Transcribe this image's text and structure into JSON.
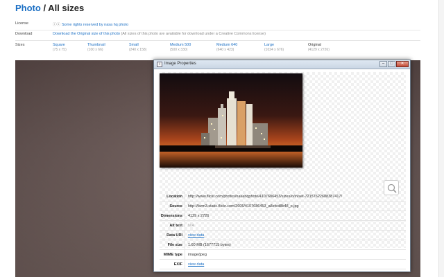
{
  "header": {
    "title_link": "Photo",
    "title_rest": " / All sizes"
  },
  "info": {
    "license_label": "License",
    "license_icons": "ⓘⓢ",
    "license_link": "Some rights reserved by nasa hq photo",
    "download_label": "Download",
    "download_link": "Download the Original size of this photo",
    "download_note": "(All sizes of this photo are available for download under a Creative Commons license)",
    "sizes_label": "Sizes",
    "sizes": [
      {
        "name": "Square",
        "dim": "(75 x 75)"
      },
      {
        "name": "Thumbnail",
        "dim": "(100 x 66)"
      },
      {
        "name": "Small",
        "dim": "(240 x 158)"
      },
      {
        "name": "Medium 500",
        "dim": "(500 x 330)"
      },
      {
        "name": "Medium 640",
        "dim": "(640 x 423)"
      },
      {
        "name": "Large",
        "dim": "(1024 x 676)"
      },
      {
        "name": "Original",
        "dim": "(4129 x 2726)"
      }
    ]
  },
  "dialog": {
    "title": "Image Properties",
    "icon_glyph": "i",
    "buttons": {
      "minimize": "–",
      "maximize": "□",
      "close": "✕"
    },
    "properties": [
      {
        "key": "Location",
        "value": "http://www.flickr.com/photos/nasahqphoto/4107686453/sizes/o/in/set-72157622688387417/",
        "style": ""
      },
      {
        "key": "Source",
        "value": "http://farm3.static.flickr.com/2605/4107686453_a8efed8b48_o.jpg",
        "style": ""
      },
      {
        "key": "Dimensions",
        "value": "4129 x 2726",
        "style": ""
      },
      {
        "key": "Alt text",
        "value": "N/A",
        "style": "muted"
      },
      {
        "key": "Data URI",
        "value": "view data",
        "style": "link"
      },
      {
        "key": "File size",
        "value": "1.60 MB (1677715 bytes)",
        "style": ""
      },
      {
        "key": "MIME type",
        "value": "image/jpeg",
        "style": ""
      },
      {
        "key": "EXIF",
        "value": "view data",
        "style": "link"
      }
    ]
  },
  "icons": {
    "zoom": "magnifier-icon"
  }
}
